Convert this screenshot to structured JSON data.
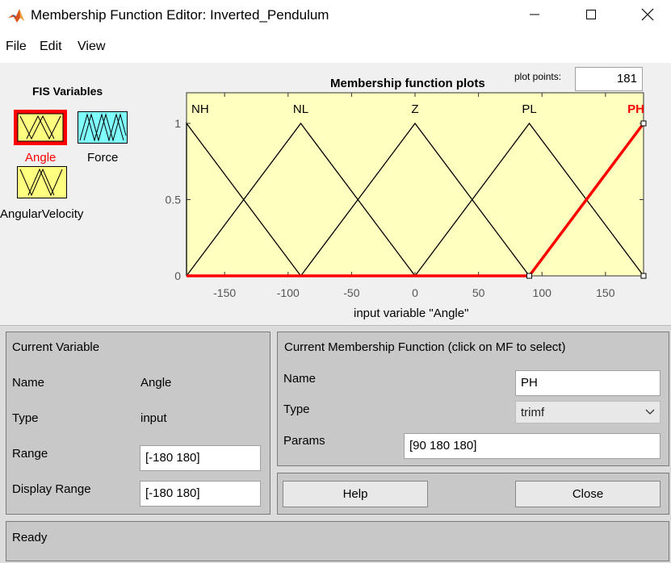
{
  "window": {
    "title": "Membership Function Editor: Inverted_Pendulum"
  },
  "menu": [
    "File",
    "Edit",
    "View"
  ],
  "fis_variables": {
    "title": "FIS Variables",
    "items": [
      {
        "label": "Angle",
        "kind": "input",
        "selected": true,
        "color": "#ffff80"
      },
      {
        "label": "Force",
        "kind": "output",
        "selected": false,
        "color": "#80ffff"
      },
      {
        "label": "AngularVelocity",
        "kind": "input",
        "selected": false,
        "color": "#ffff80"
      }
    ]
  },
  "plot": {
    "title": "Membership function plots",
    "plot_points_label": "plot points:",
    "plot_points_value": "181"
  },
  "chart_data": {
    "type": "line",
    "xlabel": "input variable \"Angle\"",
    "xlim": [
      -180,
      180
    ],
    "ylim": [
      0,
      1
    ],
    "xticks": [
      -150,
      -100,
      -50,
      0,
      50,
      100,
      150
    ],
    "xtick_labels": [
      "-150",
      "-100",
      "-50",
      "0",
      "50",
      "100",
      "150"
    ],
    "yticks": [
      0,
      0.5,
      1
    ],
    "ytick_labels": [
      "0",
      "0.5",
      "1"
    ],
    "background": "#ffffc0",
    "highlight_color": "#ff0000",
    "series": [
      {
        "name": "NH",
        "x": [
          -180,
          -180,
          -90
        ],
        "y": [
          0,
          1,
          0
        ],
        "selected": false
      },
      {
        "name": "NL",
        "x": [
          -180,
          -90,
          0
        ],
        "y": [
          0,
          1,
          0
        ],
        "selected": false
      },
      {
        "name": "Z",
        "x": [
          -90,
          0,
          90
        ],
        "y": [
          0,
          1,
          0
        ],
        "selected": false
      },
      {
        "name": "PL",
        "x": [
          0,
          90,
          180
        ],
        "y": [
          0,
          1,
          0
        ],
        "selected": false
      },
      {
        "name": "PH",
        "x": [
          90,
          180,
          180
        ],
        "y": [
          0,
          1,
          1
        ],
        "selected": true
      }
    ]
  },
  "current_variable": {
    "title": "Current Variable",
    "name_label": "Name",
    "name_value": "Angle",
    "type_label": "Type",
    "type_value": "input",
    "range_label": "Range",
    "range_value": "[-180 180]",
    "display_range_label": "Display Range",
    "display_range_value": "[-180 180]"
  },
  "current_mf": {
    "title": "Current Membership Function (click on MF to select)",
    "name_label": "Name",
    "name_value": "PH",
    "type_label": "Type",
    "type_value": "trimf",
    "params_label": "Params",
    "params_value": "[90 180 180]"
  },
  "buttons": {
    "help": "Help",
    "close": "Close"
  },
  "status": "Ready"
}
